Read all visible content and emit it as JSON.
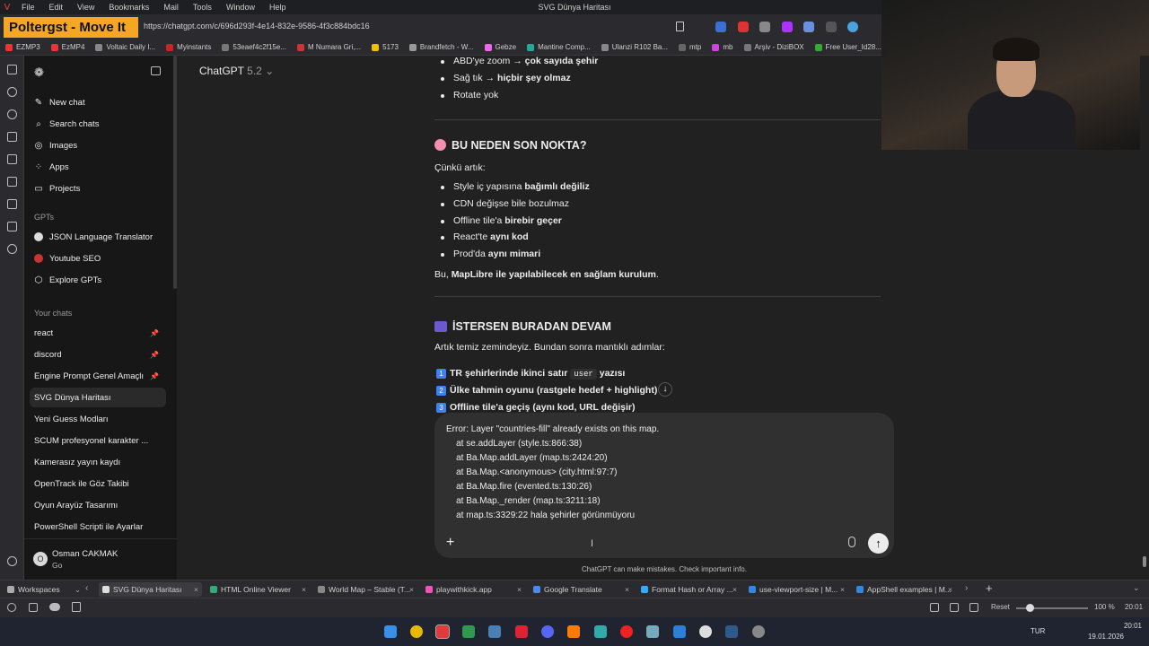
{
  "browser": {
    "menu": [
      "File",
      "Edit",
      "View",
      "Bookmarks",
      "Mail",
      "Tools",
      "Window",
      "Help"
    ],
    "window_title": "SVG Dünya Haritası",
    "overlay_title": "Poltergst - Move It",
    "url": "https://chatgpt.com/c/696d293f-4e14-832e-9586-4f3c884bdc16",
    "bookmarks": [
      "EZMP3",
      "EzMP4",
      "Voltaic Daily I...",
      "Myinstants",
      "53eaef4c2f15e...",
      "M Numara Gri,...",
      "5173",
      "Brandfetch - W...",
      "Gebze",
      "Mantine Comp...",
      "Ulanzi R102 Ba...",
      "mtp",
      "mb",
      "Arşiv - DiziBOX",
      "Free User_Id28..."
    ]
  },
  "sidebar": {
    "top_items": [
      "New chat",
      "Search chats",
      "Images",
      "Apps",
      "Projects"
    ],
    "gpts_header": "GPTs",
    "gpts": [
      "JSON Language Translator",
      "Youtube SEO",
      "Explore GPTs"
    ],
    "chats_header": "Your chats",
    "chats": [
      "react",
      "discord",
      "Engine Prompt Genel Amaçlı",
      "SVG Dünya Haritası",
      "Yeni Guess Modları",
      "SCUM profesyonel karakter ...",
      "Kamerasız yayın kaydı",
      "OpenTrack ile Göz Takibi",
      "Oyun Arayüz Tasarımı",
      "PowerShell Scripti ile Ayarlar"
    ],
    "user_name": "Osman CAKMAK",
    "user_plan": "Go",
    "user_initials": "O"
  },
  "model": {
    "name": "ChatGPT",
    "version": "5.2"
  },
  "content": {
    "b1_pre": "ABD'ye zoom → ",
    "b1_bold": "çok sayıda şehir",
    "b2_pre": "Sağ tık → ",
    "b2_bold": "hiçbir şey olmaz",
    "b3": "Rotate yok",
    "h_reason": "BU NEDEN SON NOKTA?",
    "because": "Çünkü artık:",
    "r1_pre": "Style iç yapısına ",
    "r1_bold": "bağımlı değiliz",
    "r2": "CDN değişse bile bozulmaz",
    "r3_pre": "Offline tile'a ",
    "r3_bold": "birebir geçer",
    "r4_pre": "React'te ",
    "r4_bold": "aynı kod",
    "r5_pre": "Prod'da ",
    "r5_bold": "aynı mimari",
    "summary_pre": "Bu, ",
    "summary_bold": "MapLibre ile yapılabilecek en sağlam kurulum",
    "summary_post": ".",
    "h_next": "İSTERSEN BURADAN DEVAM",
    "next_intro": "Artık temiz zemindeyiz. Bundan sonra mantıklı adımlar:",
    "n1_num": "1",
    "n1_pre": "TR şehirlerinde ikinci satır ",
    "n1_code": "user",
    "n1_post": " yazısı",
    "n2_num": "2",
    "n2": "Ülke tahmin oyunu (rastgele hedef + highlight)",
    "n3_num": "3",
    "n3": "Offline tile'a geçiş (aynı kod, URL değişir)"
  },
  "composer": {
    "lines": [
      "Error: Layer \"countries-fill\" already exists on this map.",
      "    at se.addLayer (style.ts:866:38)",
      "    at Ba.Map.addLayer (map.ts:2424:20)",
      "    at Ba.Map.<anonymous> (city.html:97:7)",
      "    at Ba.Map.fire (evented.ts:130:26)",
      "    at Ba.Map._render (map.ts:3211:18)",
      "    at map.ts:3329:22 hala şehirler görünmüyoru"
    ],
    "disclaimer": "ChatGPT can make mistakes. Check important info."
  },
  "bottom_tabs": {
    "workspaces": "Workspaces",
    "tabs": [
      "SVG Dünya Haritası",
      "HTML Online Viewer",
      "World Map – Stable (T...",
      "playwithkick.app",
      "Google Translate",
      "Format Hash or Array ...",
      "use-viewport-size | M...",
      "AppShell examples | M..."
    ]
  },
  "status": {
    "reset": "Reset",
    "zoom": "100 %",
    "clock": "20:01"
  },
  "taskbar": {
    "lang": "TUR",
    "time": "20:01",
    "date": "19.01.2026"
  },
  "colors": {
    "accent_overlay": "#f5a623",
    "send": "#ececec",
    "num_badge": "#3b82f6"
  }
}
